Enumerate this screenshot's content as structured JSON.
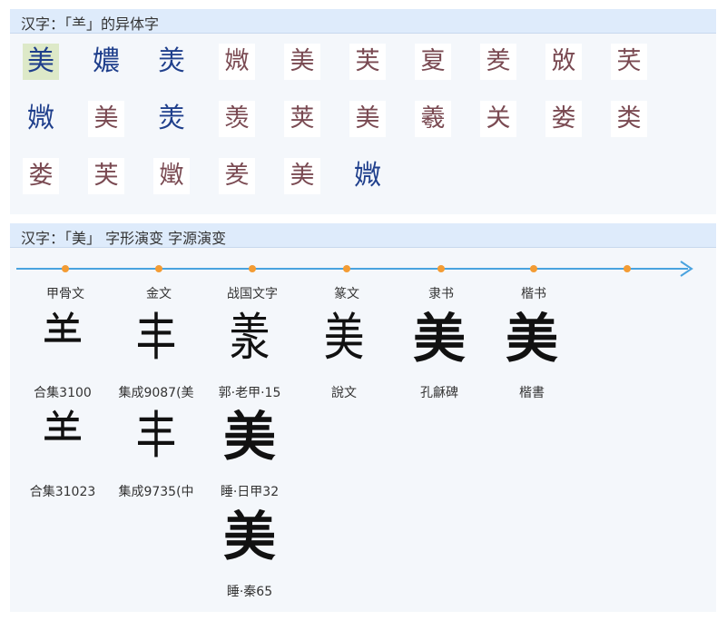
{
  "variants_section": {
    "title": "汉字：「⺷」的异体字",
    "rows": [
      [
        {
          "char": "美",
          "style": "selected"
        },
        {
          "char": "𡢿",
          "style": "blue"
        },
        {
          "char": "羙",
          "style": "blue"
        },
        {
          "char": "媺",
          "style": "img"
        },
        {
          "char": "美",
          "style": "img"
        },
        {
          "char": "芙",
          "style": "img"
        },
        {
          "char": "㚆",
          "style": "img"
        },
        {
          "char": "羑",
          "style": "img"
        },
        {
          "char": "敚",
          "style": "img"
        },
        {
          "char": "芺",
          "style": "img"
        }
      ],
      [
        {
          "char": "媺",
          "style": "blue"
        },
        {
          "char": "美",
          "style": "img"
        },
        {
          "char": "羙",
          "style": "blue"
        },
        {
          "char": "羡",
          "style": "img"
        },
        {
          "char": "荚",
          "style": "img"
        },
        {
          "char": "美",
          "style": "img"
        },
        {
          "char": "羲",
          "style": "img"
        },
        {
          "char": "关",
          "style": "img"
        },
        {
          "char": "娄",
          "style": "img"
        },
        {
          "char": "类",
          "style": "img"
        }
      ],
      [
        {
          "char": "娄",
          "style": "img"
        },
        {
          "char": "芙",
          "style": "img"
        },
        {
          "char": "嬍",
          "style": "img"
        },
        {
          "char": "羑",
          "style": "img"
        },
        {
          "char": "美",
          "style": "img"
        },
        {
          "char": "媺",
          "style": "blue"
        }
      ]
    ]
  },
  "evolution_section": {
    "title": "汉字：「美」 字形演变 字源演变",
    "eras": [
      "甲骨文",
      "金文",
      "战国文字",
      "篆文",
      "隶书",
      "楷书"
    ],
    "forms": [
      {
        "col": 0,
        "row": 0,
        "char": "⺷",
        "source": "合集3100",
        "style": "archaic"
      },
      {
        "col": 1,
        "row": 0,
        "char": "丰",
        "source": "集成9087(美",
        "style": "archaic"
      },
      {
        "col": 2,
        "row": 0,
        "char": "羕",
        "source": "郭·老甲·15",
        "style": "archaic"
      },
      {
        "col": 3,
        "row": 0,
        "char": "美",
        "source": "說文",
        "style": "archaic"
      },
      {
        "col": 4,
        "row": 0,
        "char": "美",
        "source": "孔龢碑",
        "style": "large"
      },
      {
        "col": 5,
        "row": 0,
        "char": "美",
        "source": "楷書",
        "style": "large"
      },
      {
        "col": 0,
        "row": 1,
        "char": "⺷",
        "source": "合集31023",
        "style": "archaic"
      },
      {
        "col": 1,
        "row": 1,
        "char": "丰",
        "source": "集成9735(中",
        "style": "archaic"
      },
      {
        "col": 2,
        "row": 1,
        "char": "美",
        "source": "睡·日甲32",
        "style": "large"
      },
      {
        "col": 2,
        "row": 2,
        "char": "美",
        "source": "睡·秦65",
        "style": "large"
      }
    ]
  }
}
